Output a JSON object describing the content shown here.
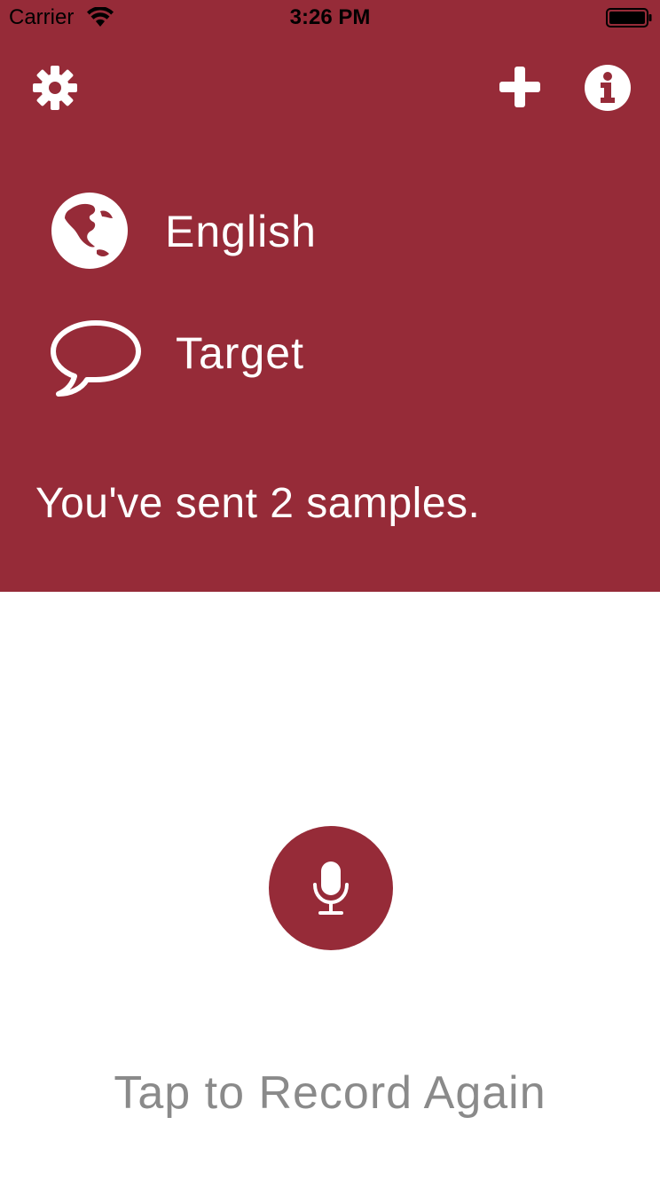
{
  "status_bar": {
    "carrier": "Carrier",
    "time": "3:26 PM"
  },
  "toolbar": {
    "settings_icon": "gear-icon",
    "add_icon": "plus-icon",
    "info_icon": "info-icon"
  },
  "language": {
    "icon": "globe-icon",
    "label": "English"
  },
  "target": {
    "icon": "speech-bubble-icon",
    "label": "Target"
  },
  "samples_message": "You've sent 2 samples.",
  "record": {
    "icon": "microphone-icon",
    "prompt": "Tap to Record Again"
  },
  "colors": {
    "brand": "#962b38",
    "prompt_text": "#8a8a8a"
  }
}
